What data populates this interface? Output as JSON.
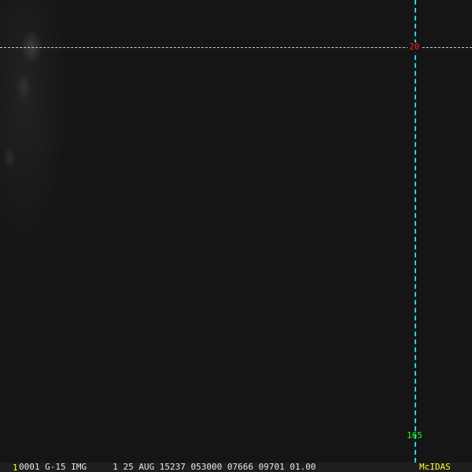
{
  "grid": {
    "latitude_label": "20",
    "longitude_label": "165",
    "line_color": "#20d8e8",
    "lat_label_color": "#ff2020",
    "lon_label_color": "#20ff20"
  },
  "status_bar": {
    "frame_number": "1",
    "info": "0001 G-15 IMG     1 25 AUG 15237 053000 07666 09701 01.00",
    "brand": "McIDAS"
  }
}
